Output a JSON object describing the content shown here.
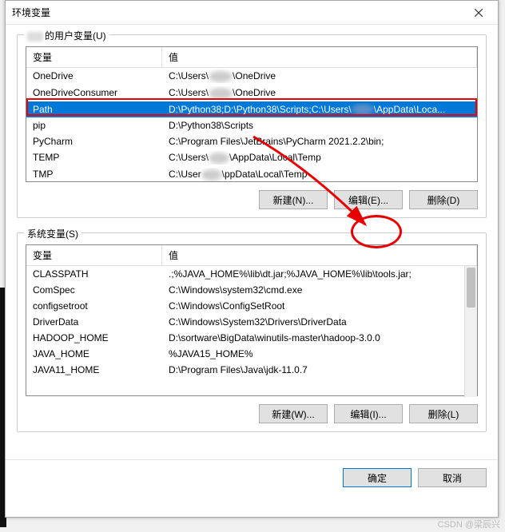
{
  "dialog": {
    "title": "环境变量",
    "close_icon": "×"
  },
  "userVars": {
    "label_prefix": "的用户变量(U)",
    "header_var": "变量",
    "header_val": "值",
    "rows": [
      {
        "var": "OneDrive",
        "val_left": "C:\\Users\\",
        "val_right": "OneDrive"
      },
      {
        "var": "OneDriveConsumer",
        "val_left": "C:\\Users\\",
        "val_right": "OneDrive"
      },
      {
        "var": "Path",
        "val_left": "D:\\Python38;D:\\Python38\\Scripts;C:\\Users\\",
        "val_right": "\\AppData\\Loca..."
      },
      {
        "var": "pip",
        "val_left": "D:\\Python38\\Scripts",
        "val_right": ""
      },
      {
        "var": "PyCharm",
        "val_left": "C:\\Program Files\\JetBrains\\PyCharm 2021.2.2\\bin;",
        "val_right": ""
      },
      {
        "var": "TEMP",
        "val_left": "C:\\Users\\",
        "val_right": "\\AppData\\Local\\Temp"
      },
      {
        "var": "TMP",
        "val_left": "C:\\User",
        "val_right": "\\ppData\\Local\\Temp"
      }
    ],
    "btn_new": "新建(N)...",
    "btn_edit": "编辑(E)...",
    "btn_delete": "删除(D)"
  },
  "sysVars": {
    "label": "系统变量(S)",
    "header_var": "变量",
    "header_val": "值",
    "rows": [
      {
        "var": "CLASSPATH",
        "val": ".;%JAVA_HOME%\\lib\\dt.jar;%JAVA_HOME%\\lib\\tools.jar;"
      },
      {
        "var": "ComSpec",
        "val": "C:\\Windows\\system32\\cmd.exe"
      },
      {
        "var": "configsetroot",
        "val": "C:\\Windows\\ConfigSetRoot"
      },
      {
        "var": "DriverData",
        "val": "C:\\Windows\\System32\\Drivers\\DriverData"
      },
      {
        "var": "HADOOP_HOME",
        "val": "D:\\sortware\\BigData\\winutils-master\\hadoop-3.0.0"
      },
      {
        "var": "JAVA_HOME",
        "val": "%JAVA15_HOME%"
      },
      {
        "var": "JAVA11_HOME",
        "val": "D:\\Program Files\\Java\\jdk-11.0.7"
      }
    ],
    "btn_new": "新建(W)...",
    "btn_edit": "编辑(I)...",
    "btn_delete": "删除(L)"
  },
  "dialogButtons": {
    "ok": "确定",
    "cancel": "取消"
  },
  "watermark": "CSDN @梁辰兴"
}
